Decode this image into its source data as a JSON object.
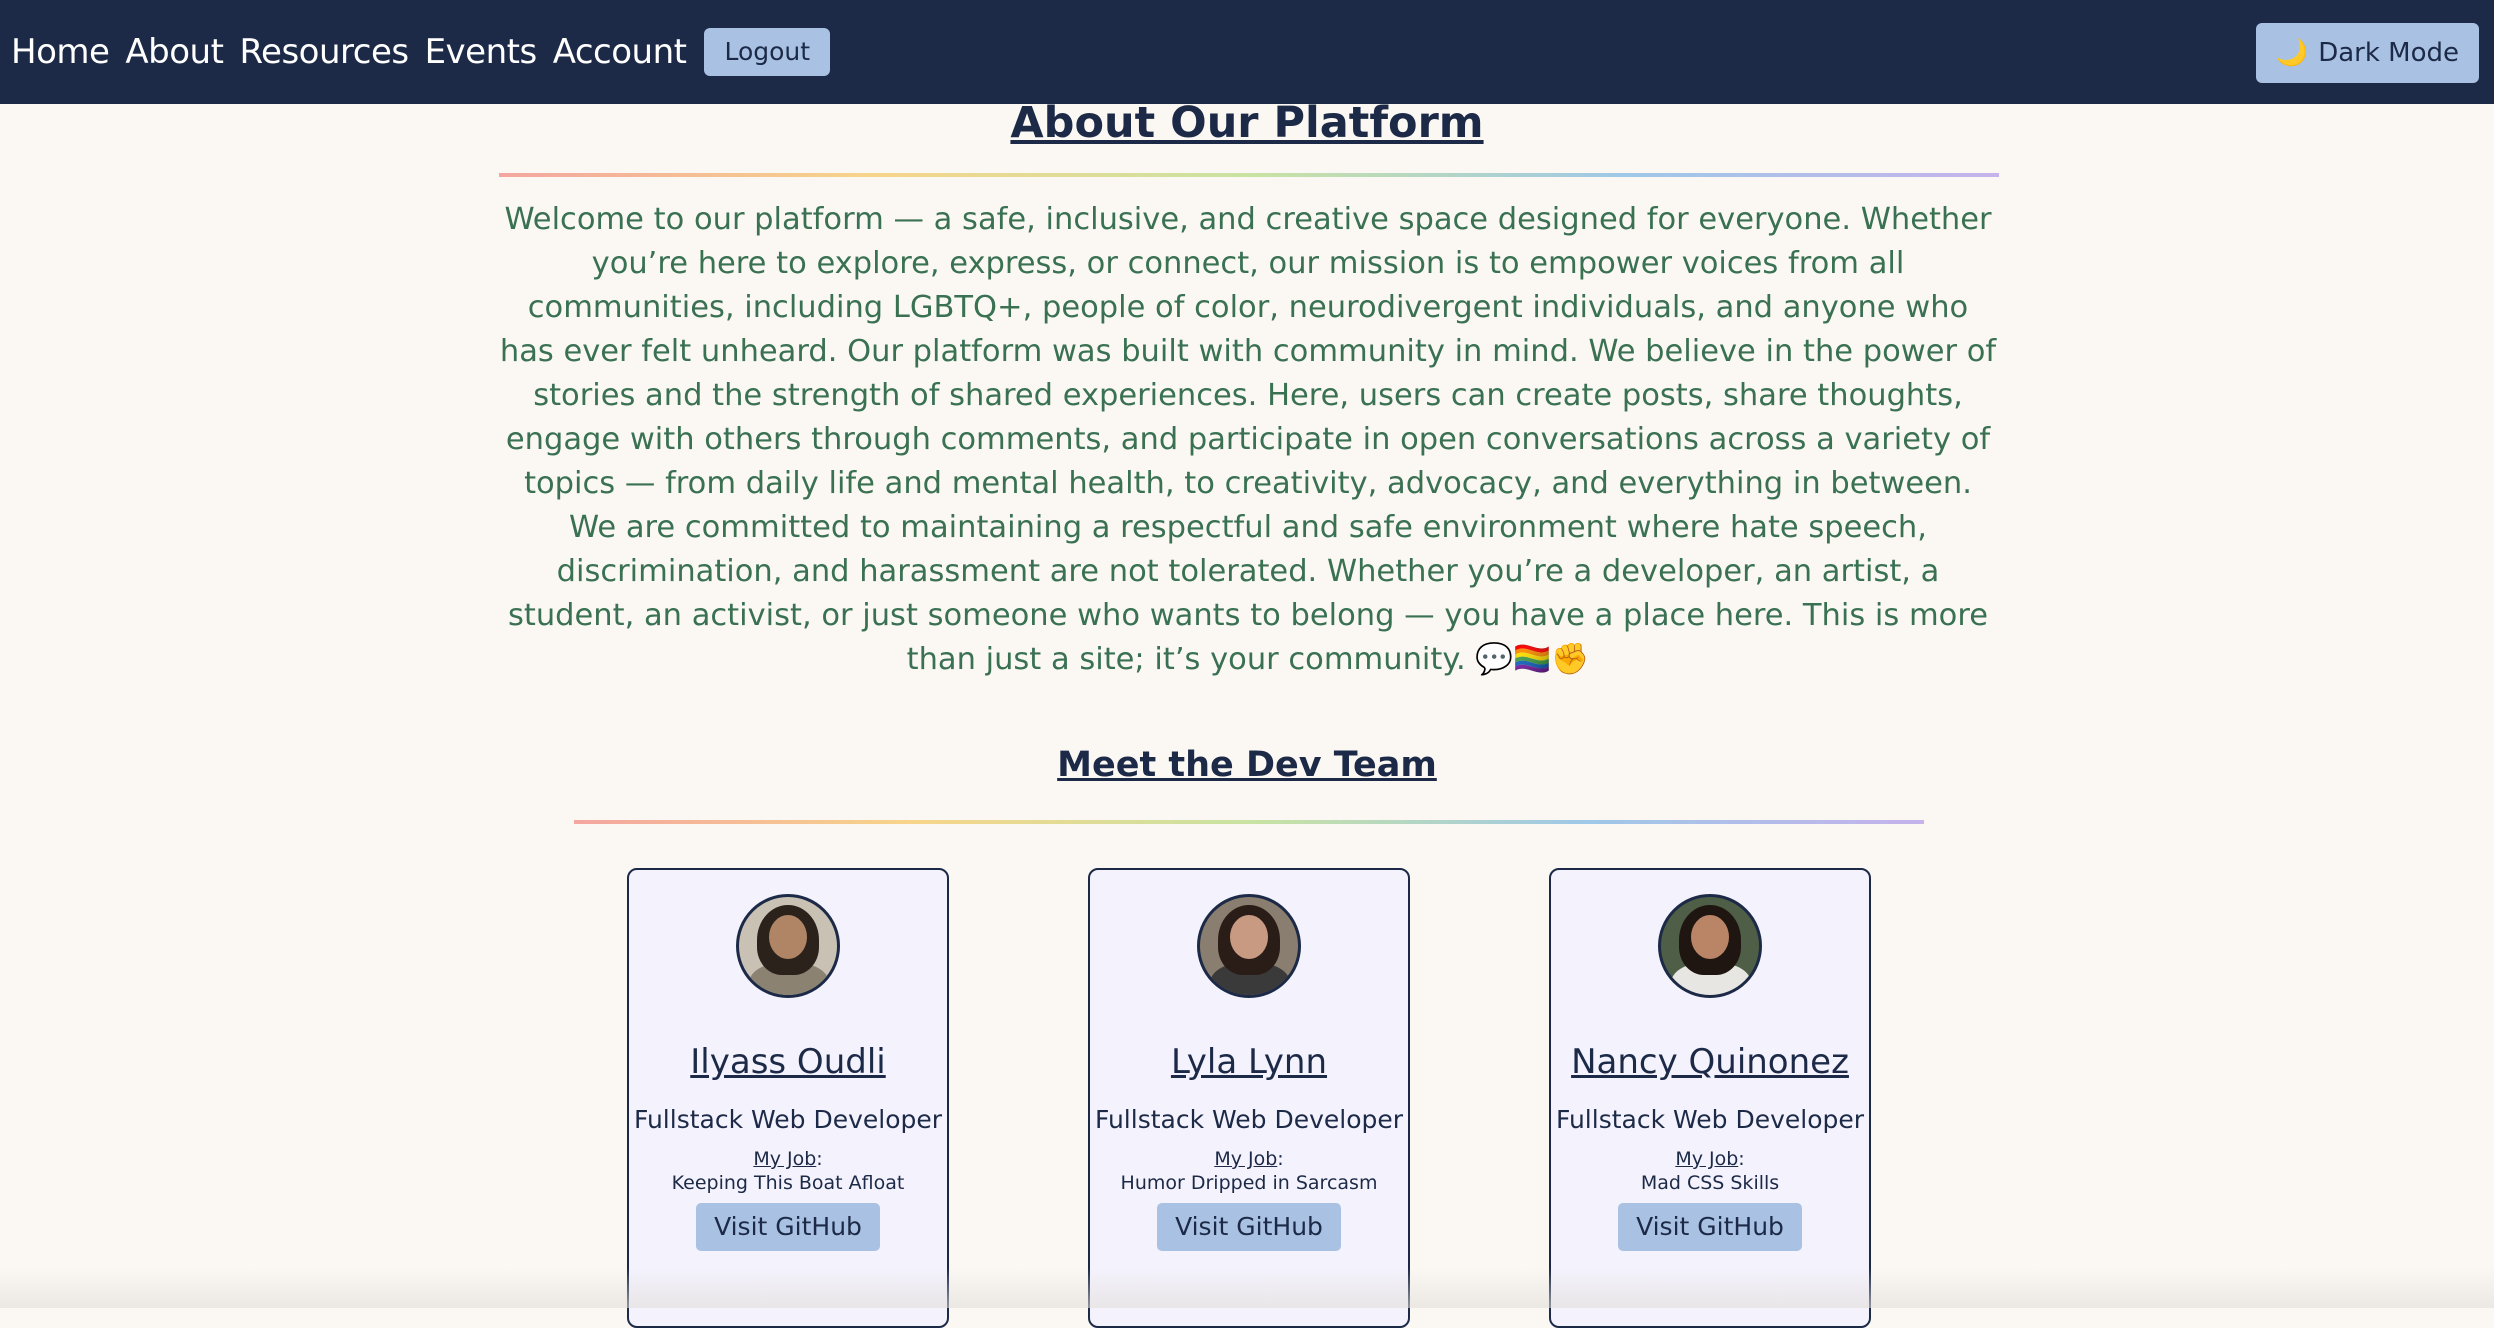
{
  "nav": {
    "links": [
      "Home",
      "About",
      "Resources",
      "Events",
      "Account"
    ],
    "logout_label": "Logout",
    "dark_mode_label": "Dark Mode",
    "dark_mode_icon": "🌙"
  },
  "about": {
    "title": "About Our Platform",
    "text": "Welcome to our platform — a safe, inclusive, and creative space designed for everyone. Whether you’re here to explore, express, or connect, our mission is to empower voices from all communities, including LGBTQ+, people of color, neurodivergent individuals, and anyone who has ever felt unheard. Our platform was built with community in mind. We believe in the power of stories and the strength of shared experiences. Here, users can create posts, share thoughts, engage with others through comments, and participate in open conversations across a variety of topics — from daily life and mental health, to creativity, advocacy, and everything in between. We are committed to maintaining a respectful and safe environment where hate speech, discrimination, and harassment are not tolerated. Whether you’re a developer, an artist, a student, an activist, or just someone who wants to belong — you have a place here. This is more than just a site; it’s your community. 💬🏳️‍🌈✊"
  },
  "team": {
    "title": "Meet the Dev Team",
    "members": [
      {
        "name": "Ilyass Oudli",
        "role": "Fullstack Web Developer",
        "job_label": "My Job",
        "job": "Keeping This Boat Afloat",
        "github_label": "Visit GitHub"
      },
      {
        "name": "Lyla Lynn",
        "role": "Fullstack Web Developer",
        "job_label": "My Job",
        "job": "Humor Dripped in Sarcasm",
        "github_label": "Visit GitHub"
      },
      {
        "name": "Nancy Quinonez",
        "role": "Fullstack Web Developer",
        "job_label": "My Job",
        "job": "Mad CSS Skills",
        "github_label": "Visit GitHub"
      }
    ]
  },
  "colors": {
    "navbar": "#1c2a48",
    "button": "#a9c1e2",
    "background": "#fbf8f3",
    "about_text": "#3a7153",
    "card_bg": "#f4f2fc"
  }
}
